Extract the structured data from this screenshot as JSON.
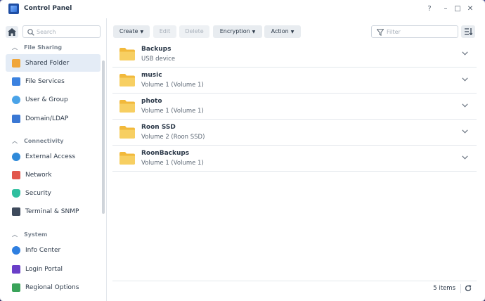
{
  "window": {
    "title": "Control Panel",
    "controls": {
      "help": "?",
      "minimize": "–",
      "maximize": "□",
      "close": "✕"
    }
  },
  "sidebar": {
    "search_placeholder": "Search",
    "sections": [
      {
        "label": "File Sharing",
        "items": [
          {
            "label": "Shared Folder",
            "icon": "shared-folder-icon",
            "active": true
          },
          {
            "label": "File Services",
            "icon": "file-services-icon"
          },
          {
            "label": "User & Group",
            "icon": "user-group-icon"
          },
          {
            "label": "Domain/LDAP",
            "icon": "domain-ldap-icon"
          }
        ]
      },
      {
        "label": "Connectivity",
        "items": [
          {
            "label": "External Access",
            "icon": "external-access-icon"
          },
          {
            "label": "Network",
            "icon": "network-icon"
          },
          {
            "label": "Security",
            "icon": "security-icon"
          },
          {
            "label": "Terminal & SNMP",
            "icon": "terminal-icon"
          }
        ]
      },
      {
        "label": "System",
        "items": [
          {
            "label": "Info Center",
            "icon": "info-center-icon"
          },
          {
            "label": "Login Portal",
            "icon": "login-portal-icon"
          },
          {
            "label": "Regional Options",
            "icon": "regional-options-icon"
          }
        ]
      }
    ]
  },
  "toolbar": {
    "create": "Create",
    "edit": "Edit",
    "delete": "Delete",
    "encryption": "Encryption",
    "action": "Action",
    "filter_placeholder": "Filter"
  },
  "folders": [
    {
      "name": "Backups",
      "location": "USB device"
    },
    {
      "name": "music",
      "location": "Volume 1 (Volume 1)"
    },
    {
      "name": "photo",
      "location": "Volume 1 (Volume 1)"
    },
    {
      "name": "Roon SSD",
      "location": "Volume 2 (Roon SSD)"
    },
    {
      "name": "RoonBackups",
      "location": "Volume 1 (Volume 1)"
    }
  ],
  "footer": {
    "count": "5 items"
  },
  "colors": {
    "accent": "#2e6fd6",
    "folder": "#f5c342",
    "active_bg": "#e4ecf6"
  }
}
